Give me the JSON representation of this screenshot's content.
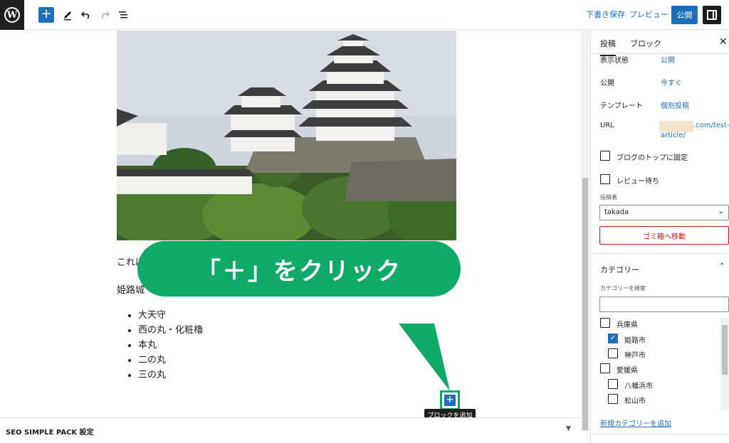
{
  "toolbar": {
    "draft_label": "下書き保存",
    "preview_label": "プレビュー",
    "publish_label": "公開"
  },
  "editor": {
    "paragraph1": "これは姫路城の写真です。",
    "paragraph2": "姫路城",
    "list_items": [
      "大天守",
      "西の丸・化粧櫓",
      "本丸",
      "二の丸",
      "三の丸"
    ],
    "callout_text": "「＋」をクリック",
    "inserter_tooltip": "ブロックを追加"
  },
  "metabox": {
    "title": "SEO SIMPLE PACK 設定"
  },
  "sidebar": {
    "tabs": [
      "投稿",
      "ブロック"
    ],
    "rows": [
      {
        "label": "表示状態",
        "value": "公開"
      },
      {
        "label": "公開",
        "value": "今すぐ"
      },
      {
        "label": "テンプレート",
        "value": "個別投稿"
      }
    ],
    "url_label": "URL",
    "url_value_line1": ".com/test-",
    "url_value_line2": "article/",
    "sticky_label": "ブログのトップに固定",
    "pending_label": "レビュー待ち",
    "author_label": "投稿者",
    "author_value": "takada",
    "trash_label": "ゴミ箱へ移動",
    "categories_title": "カテゴリー",
    "category_search_label": "カテゴリーを検索",
    "categories": [
      {
        "name": "兵庫県",
        "checked": false,
        "child": false
      },
      {
        "name": "姫路市",
        "checked": true,
        "child": true
      },
      {
        "name": "神戸市",
        "checked": false,
        "child": true
      },
      {
        "name": "愛媛県",
        "checked": false,
        "child": false
      },
      {
        "name": "八幡浜市",
        "checked": false,
        "child": true
      },
      {
        "name": "松山市",
        "checked": false,
        "child": true
      }
    ],
    "add_category_label": "新規カテゴリーを追加"
  },
  "colors": {
    "accent": "#1d6fb8",
    "callout": "#0fa968",
    "danger": "#cc1818"
  }
}
